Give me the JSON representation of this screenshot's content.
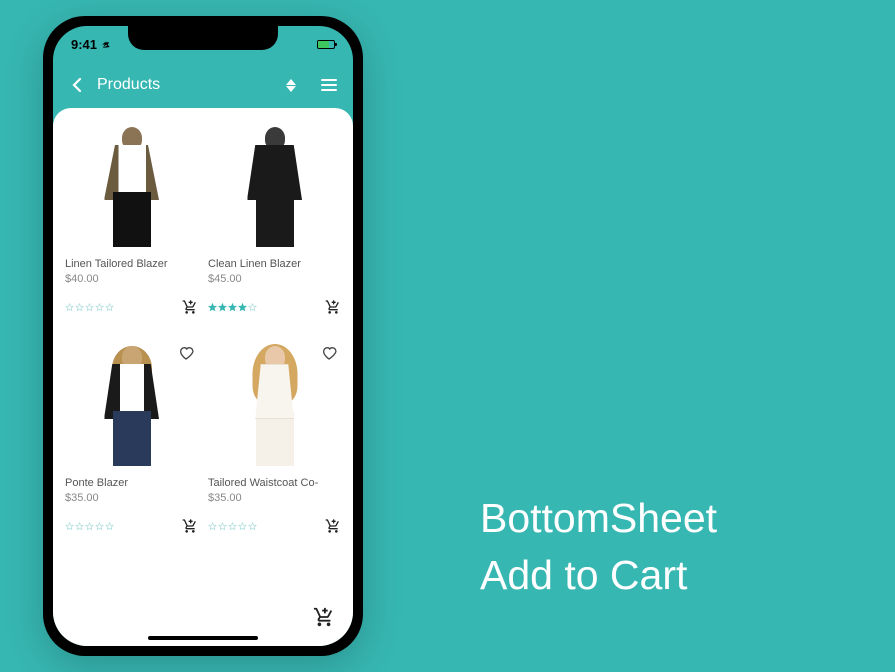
{
  "status": {
    "time": "9:41"
  },
  "header": {
    "title": "Products"
  },
  "colors": {
    "accent": "#37b7b2",
    "star_filled": "#37b7b2",
    "star_empty": "#b0dedc"
  },
  "products": [
    {
      "name": "Linen Tailored Blazer",
      "price": "$40.00",
      "rating": 0
    },
    {
      "name": "Clean Linen Blazer",
      "price": "$45.00",
      "rating": 4
    },
    {
      "name": "Ponte Blazer",
      "price": "$35.00",
      "rating": 0
    },
    {
      "name": "Tailored Waistcoat Co-",
      "price": "$35.00",
      "rating": 0
    }
  ],
  "headline": {
    "line1": "BottomSheet",
    "line2": "Add to Cart"
  }
}
